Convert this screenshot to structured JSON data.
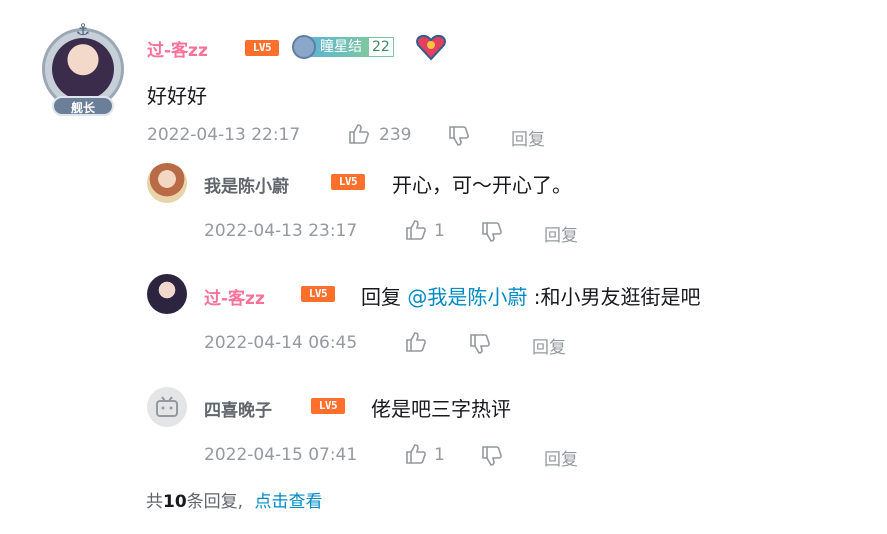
{
  "main": {
    "avatar_rank": "舰长",
    "username": "过-客zz",
    "level_label": "LV5",
    "medal": {
      "name": "瞳星结",
      "level": "22"
    },
    "text": "好好好",
    "time": "2022-04-13 22:17",
    "likes": "239",
    "reply_label": "回复"
  },
  "replies": [
    {
      "username": "我是陈小蔚",
      "level_label": "LV5",
      "text": "开心，可～开心了。",
      "time": "2022-04-13 23:17",
      "likes": "1",
      "reply_label": "回复"
    },
    {
      "username": "过-客zz",
      "level_label": "LV5",
      "text_prefix": "回复",
      "mention": "@我是陈小蔚",
      "text_suffix": ":和小男友逛街是吧",
      "time": "2022-04-14 06:45",
      "likes": "",
      "reply_label": "回复"
    },
    {
      "username": "四喜晚子",
      "level_label": "LV5",
      "text": "佬是吧三字热评",
      "time": "2022-04-15 07:41",
      "likes": "1",
      "reply_label": "回复"
    }
  ],
  "footer": {
    "prefix": "共",
    "count": "10",
    "suffix": "条回复,",
    "link": "点击查看"
  },
  "colors": {
    "pink_name": "#fb7299",
    "link": "#008ac5",
    "level_badge": "#ff6f2c",
    "meta_gray": "#9499a0"
  }
}
